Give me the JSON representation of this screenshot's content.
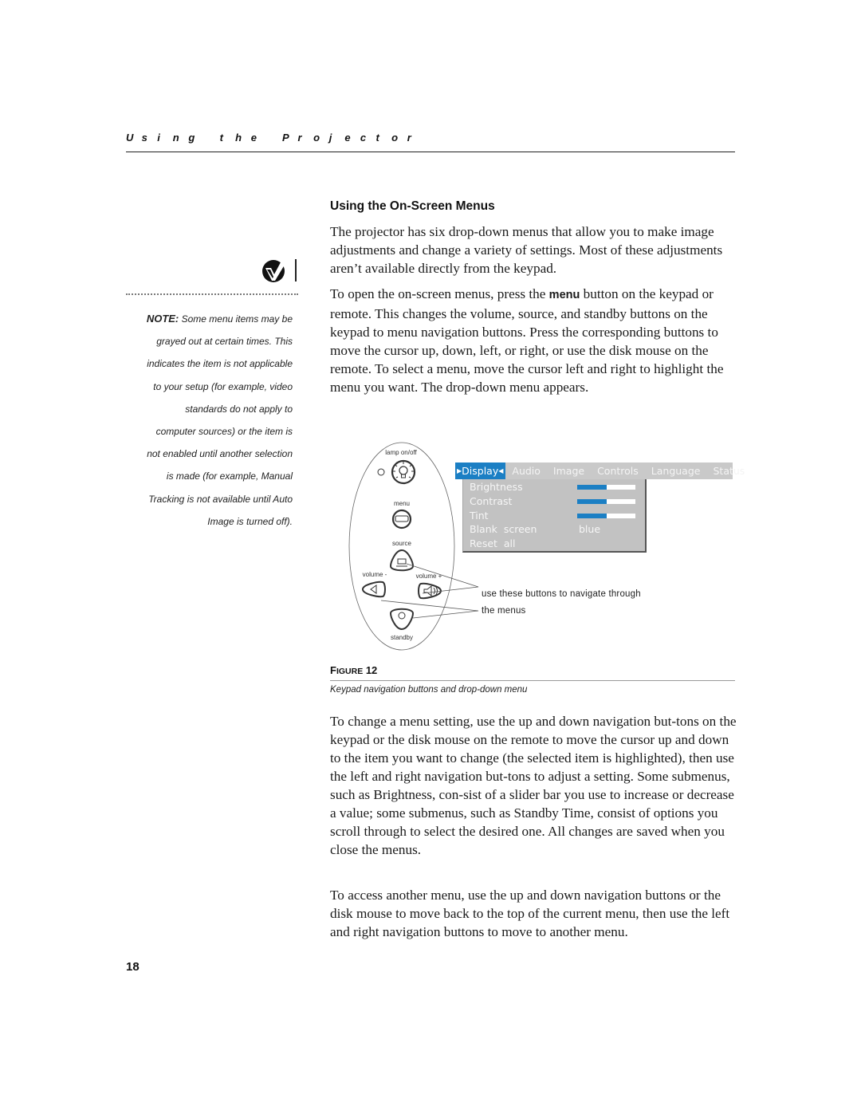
{
  "running_header": "Using the Projector",
  "side_note": {
    "icon": "note-checkmark-icon",
    "label": "NOTE:",
    "lines": [
      " Some menu items may be",
      "grayed out at certain times. This",
      "indicates the item is not applicable",
      "to your setup (for example, video",
      "standards do not apply to",
      "computer sources) or the item is",
      "not enabled until another selection",
      "is made (for example, Manual",
      "Tracking is not available until Auto",
      "Image is turned off)."
    ]
  },
  "section_title": "Using the On-Screen Menus",
  "paragraphs": {
    "p1": "The projector has six drop-down menus that allow you to make image adjustments and change a variety of settings. Most of these adjustments aren’t available directly from the keypad.",
    "p2_before": "To open the on-screen menus, press the ",
    "p2_keyword": "menu",
    "p2_after": " button on the keypad or remote. This changes the volume, source, and standby buttons on the keypad to menu navigation buttons. Press the corresponding buttons to move the cursor up, down, left, or right, or use the disk mouse on the remote. To select a menu, move the cursor left and right to highlight the menu you want. The drop-down menu appears.",
    "p3": "To change a menu setting, use the up and down navigation but-tons on the keypad or the disk mouse on the remote to move the cursor up and down to the item you want to change (the selected item is highlighted), then use the left and right navigation but-tons to adjust a setting. Some submenus, such as Brightness, con-sist of a slider bar you use to increase or decrease a value; some submenus, such as Standby Time, consist of options you scroll through to select the desired one. All changes are saved when you close the menus.",
    "p4": "To access another menu, use the up and down navigation buttons or the disk mouse to move back to the top of the current menu, then use the left and right navigation buttons to move to another menu."
  },
  "figure": {
    "remote": {
      "lamp_label": "lamp on/off",
      "menu_label": "menu",
      "source_label": "source",
      "volume_minus_label": "volume -",
      "volume_plus_label": "volume +",
      "standby_label": "standby"
    },
    "osd_menu": {
      "tabs": [
        "Display",
        "Audio",
        "Image",
        "Controls",
        "Language",
        "Status"
      ],
      "active_tab": "Display",
      "items": [
        {
          "label": "Brightness",
          "type": "slider",
          "value_fraction": 0.5
        },
        {
          "label": "Contrast",
          "type": "slider",
          "value_fraction": 0.5
        },
        {
          "label": "Tint",
          "type": "slider",
          "value_fraction": 0.5
        },
        {
          "label": "Blank  screen",
          "type": "value",
          "value": "blue"
        },
        {
          "label": "Reset  all",
          "type": "action"
        }
      ],
      "colors": {
        "highlight": "#1b7fc4",
        "menu_bg": "#c2c2c2",
        "text": "#f6f6f6"
      }
    },
    "callout_lines": [
      "use these buttons to navigate through",
      "the menus"
    ],
    "label_first": "F",
    "label_smallcaps": "IGURE",
    "label_number": " 12",
    "caption": "Keypad navigation buttons and drop-down menu"
  },
  "page_number": "18"
}
